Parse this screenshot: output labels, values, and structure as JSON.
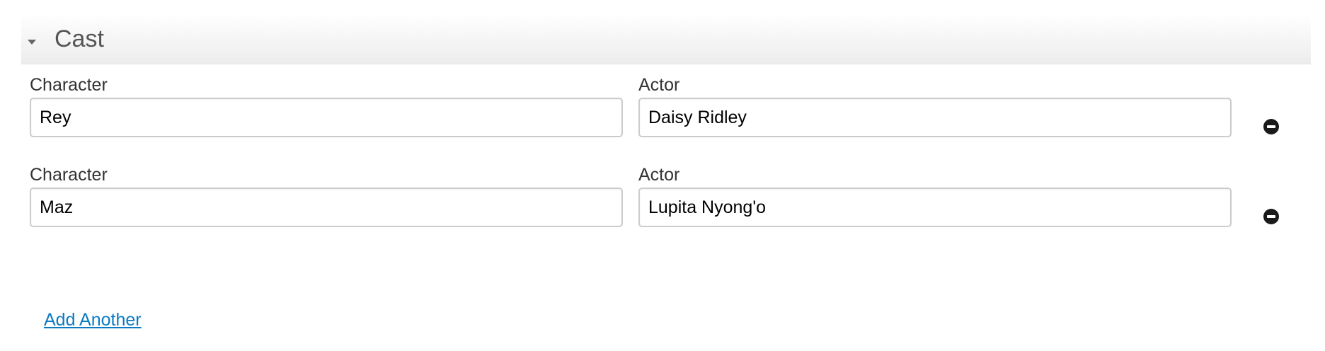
{
  "section": {
    "title": "Cast",
    "expanded": true,
    "toggle_icon": "triangle-down-icon"
  },
  "cast_rows": [
    {
      "character_label": "Character",
      "character_value": "Rey",
      "actor_label": "Actor",
      "actor_value": "Daisy Ridley",
      "remove_icon": "minus-circle-icon"
    },
    {
      "character_label": "Character",
      "character_value": "Maz",
      "actor_label": "Actor",
      "actor_value": "Lupita Nyong'o",
      "remove_icon": "minus-circle-icon"
    }
  ],
  "add_link": {
    "label": "Add Another"
  },
  "colors": {
    "link": "#0a7bc2",
    "header_gradient_top": "#ffffff",
    "header_gradient_bottom": "#ececec"
  }
}
